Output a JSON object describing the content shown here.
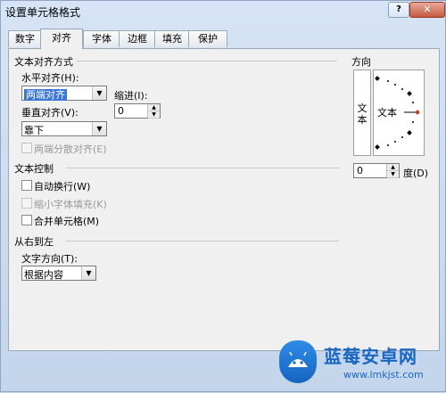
{
  "window": {
    "title": "设置单元格格式",
    "help_label": "?",
    "close_label": "✕"
  },
  "tabs": [
    {
      "label": "数字"
    },
    {
      "label": "对齐"
    },
    {
      "label": "字体"
    },
    {
      "label": "边框"
    },
    {
      "label": "填充"
    },
    {
      "label": "保护"
    }
  ],
  "active_tab": "对齐",
  "alignment": {
    "section_title": "文本对齐方式",
    "horizontal_label": "水平对齐(H):",
    "horizontal_value": "两端对齐",
    "indent_label": "缩进(I):",
    "indent_value": "0",
    "vertical_label": "垂直对齐(V):",
    "vertical_value": "靠下",
    "justify_distributed_label": "两端分散对齐(E)"
  },
  "text_control": {
    "section_title": "文本控制",
    "wrap_text_label": "自动换行(W)",
    "shrink_to_fit_label": "缩小字体填充(K)",
    "merge_cells_label": "合并单元格(M)"
  },
  "rtl": {
    "section_title": "从右到左",
    "direction_label": "文字方向(T):",
    "direction_value": "根据内容"
  },
  "orientation": {
    "section_title": "方向",
    "vertical_text": "文本",
    "dial_text": "文本",
    "degrees_value": "0",
    "degrees_label": "度(D)"
  },
  "watermark": {
    "title": "蓝莓安卓网",
    "url": "www.lmkjst.com"
  },
  "colors": {
    "accent": "#3875d7",
    "marker": "#c0392b"
  }
}
